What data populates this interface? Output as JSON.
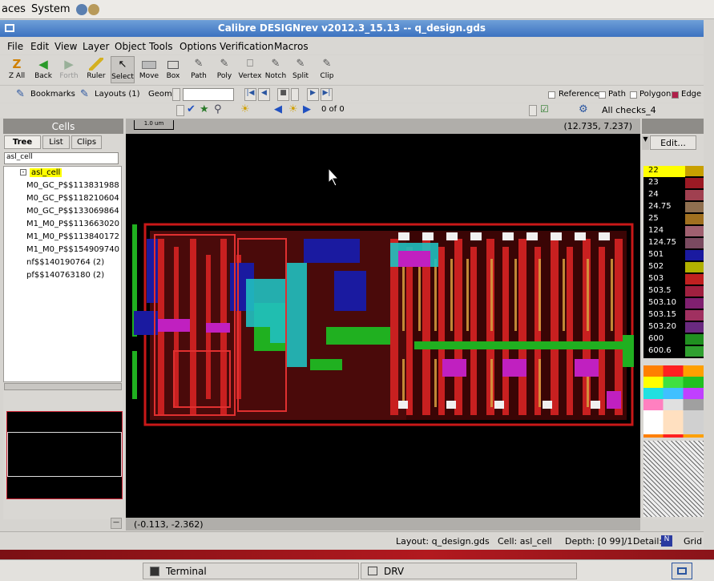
{
  "system_bar": {
    "places": "aces",
    "system": "System"
  },
  "window": {
    "title": "Calibre DESIGNrev v2012.3_15.13  --  q_design.gds"
  },
  "menu": [
    "File",
    "Edit",
    "View",
    "Layer",
    "Object",
    "Tools",
    "Options",
    "Verification",
    "Macros"
  ],
  "toolbar": [
    "Z All",
    "Back",
    "Forth",
    "Ruler",
    "Select",
    "Move",
    "Box",
    "Path",
    "Poly",
    "Vertex",
    "Notch",
    "Split",
    "Clip"
  ],
  "nav_bar": {
    "bookmarks": "Bookmarks",
    "layouts": "Layouts (1)",
    "geom": "Geom:",
    "filters": [
      "Reference",
      "Path",
      "Polygon",
      "Edge"
    ]
  },
  "rve_bar": {
    "counter": "0 of 0",
    "checks": "All checks_4"
  },
  "cells_panel": {
    "title": "Cells",
    "tabs": [
      "Tree",
      "List",
      "Clips"
    ],
    "filter_value": "asl_cell",
    "root": "asl_cell",
    "items": [
      "M0_GC_P$$113831988",
      "M0_GC_P$$118210604",
      "M0_GC_P$$133069864",
      "M1_M0_P$$113663020",
      "M1_M0_P$$113840172",
      "M1_M0_P$$154909740",
      "nf$$140190764  (2)",
      "pf$$140763180  (2)"
    ]
  },
  "canvas": {
    "scale_label": "1.0 um",
    "cursor_coords": "(12.735, 7.237)",
    "origin_coords": "(-0.113, -2.362)"
  },
  "layers_panel": {
    "edit_label": "Edit...",
    "layers": [
      {
        "name": "22",
        "color": "#c8a000"
      },
      {
        "name": "23",
        "color": "#9c1a24"
      },
      {
        "name": "24",
        "color": "#a04050"
      },
      {
        "name": "24.75",
        "color": "#907050"
      },
      {
        "name": "25",
        "color": "#a07020"
      },
      {
        "name": "124",
        "color": "#a06070"
      },
      {
        "name": "124.75",
        "color": "#7a4a60"
      },
      {
        "name": "501",
        "color": "#1a1aa0"
      },
      {
        "name": "502",
        "color": "#b0b000"
      },
      {
        "name": "503",
        "color": "#c02020"
      },
      {
        "name": "503.5",
        "color": "#a02040"
      },
      {
        "name": "503.10",
        "color": "#802070"
      },
      {
        "name": "503.15",
        "color": "#a03060"
      },
      {
        "name": "503.20",
        "color": "#6a2a80"
      },
      {
        "name": "600",
        "color": "#209020"
      },
      {
        "name": "600.6",
        "color": "#30a030"
      }
    ]
  },
  "status": {
    "layout": "Layout:  q_design.gds",
    "cell": "Cell:  asl_cell",
    "depth": "Depth:  [0  99]/1",
    "detail": "Detail:",
    "grid": "Grid"
  },
  "taskbar": {
    "terminal": "Terminal",
    "drv": "DRV"
  }
}
